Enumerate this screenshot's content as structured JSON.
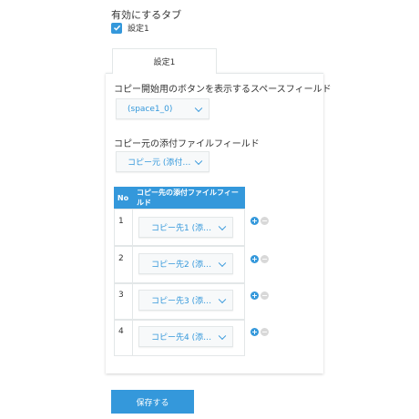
{
  "section": {
    "title": "有効にするタブ"
  },
  "tab_checkbox": {
    "label": "設定1",
    "checked": true
  },
  "tab": {
    "label": "設定1"
  },
  "space_field": {
    "label": "コピー開始用のボタンを表示するスペースフィールド",
    "selected": "(space1_0)"
  },
  "source_field": {
    "label": "コピー元の添付ファイルフィールド",
    "selected": "コピー元 (添付…"
  },
  "table": {
    "headers": [
      "No",
      "コピー先の添付ファイルフィールド"
    ],
    "rows": [
      {
        "no": "1",
        "value": "コピー先1 (添…"
      },
      {
        "no": "2",
        "value": "コピー先2 (添…"
      },
      {
        "no": "3",
        "value": "コピー先3 (添…"
      },
      {
        "no": "4",
        "value": "コピー先4 (添…"
      }
    ]
  },
  "actions": {
    "save_label": "保存する"
  },
  "colors": {
    "accent": "#3498db",
    "border": "#e3e7e8",
    "dropdown_bg": "#f7f9fa"
  }
}
